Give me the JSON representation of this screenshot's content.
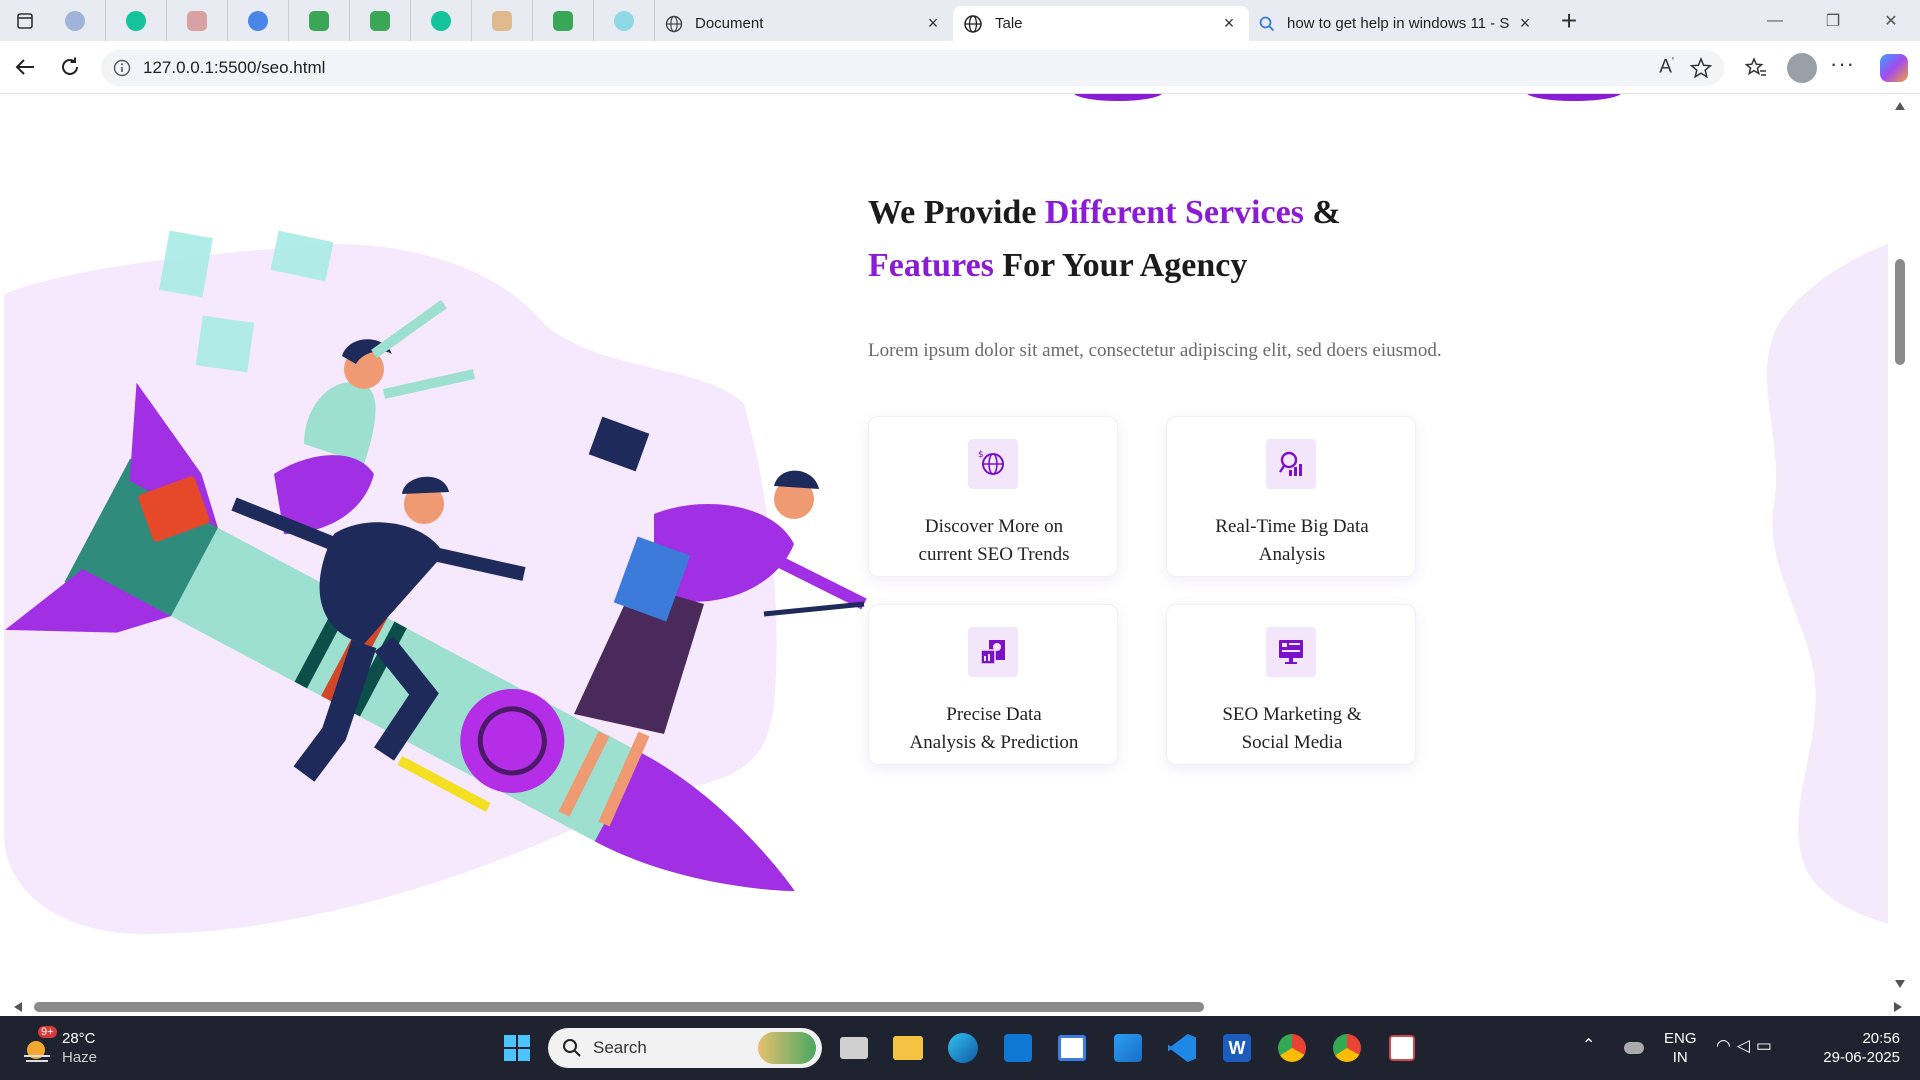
{
  "browser": {
    "tabs": [
      {
        "title": "Document",
        "close": "×"
      },
      {
        "title": "Tale",
        "close": "×"
      },
      {
        "title": "how to get help in windows 11 - S",
        "close": "×"
      }
    ],
    "new_tab": "+",
    "url": "127.0.0.1:5500/seo.html",
    "window_controls": {
      "minimize": "—",
      "restore": "❐",
      "close": "✕"
    }
  },
  "section": {
    "heading_part1": "We Provide ",
    "heading_highlight1": "Different Services",
    "heading_part2": " &",
    "heading_highlight2": "Features",
    "heading_part3": " For Your Agency",
    "lead": "Lorem ipsum dolor sit amet, consectetur adipiscing elit, sed doers eiusmod.",
    "accent_color": "#8a1cd6",
    "cards": [
      {
        "line1": "Discover More on",
        "line2": "current SEO Trends",
        "icon": "globe-dollar-icon"
      },
      {
        "line1": "Real-Time Big Data",
        "line2": "Analysis",
        "icon": "search-chart-icon"
      },
      {
        "line1": "Precise Data",
        "line2": "Analysis & Prediction",
        "icon": "data-document-icon"
      },
      {
        "line1": "SEO Marketing &",
        "line2": "Social Media",
        "icon": "monitor-chart-icon"
      }
    ]
  },
  "taskbar": {
    "weather_temp": "28°C",
    "weather_desc": "Haze",
    "weather_badge": "9+",
    "search_placeholder": "Search",
    "lang_line1": "ENG",
    "lang_line2": "IN",
    "time": "20:56",
    "date": "29-06-2025"
  }
}
